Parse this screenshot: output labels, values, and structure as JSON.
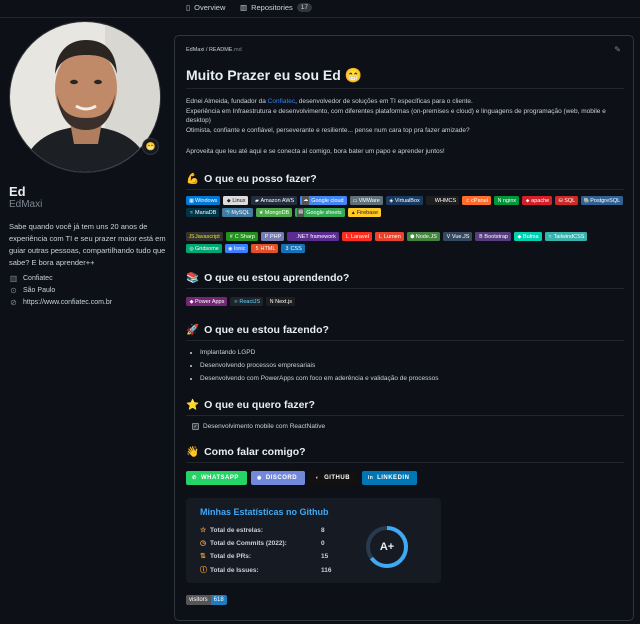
{
  "nav": {
    "overview": "Overview",
    "repositories": "Repositories",
    "repo_count": "17"
  },
  "profile": {
    "name": "Ed",
    "login": "EdMaxi",
    "status_emoji": "😁",
    "bio": "Sabe quando você já tem uns 20 anos de experiência com TI e seu prazer maior está em guiar outras pessoas, compartilhando tudo que sabe? E bora aprender++",
    "company": "Confiatec",
    "location": "São Paulo",
    "website": "https://www.confiatec.com.br"
  },
  "readme": {
    "crumb_user": "EdMaxi",
    "crumb_sep": " / ",
    "crumb_file": "README",
    "crumb_ext": ".md",
    "title": "Muito Prazer eu sou Ed 😁",
    "intro_a": "Ednei Almeida, fundador da ",
    "intro_link": "Confiatec",
    "intro_b": ", desenvolvedor de soluções em TI específicas para o cliente.",
    "intro_2": "Experiência em Infraestrutura e desenvolvimento, com diferentes plataformas (on-premises e cloud) e linguagens de programação (web, mobile e desktop)",
    "intro_3": "Otimista, confiante e confiável, perseverante e resiliente... pense num cara top pra fazer amizade?",
    "intro_4": "Aproveita que leu até aqui e se conecta aí comigo, bora bater um papo e aprender juntos!",
    "h_can": "O que eu posso fazer?",
    "h_can_icon": "💪",
    "h_learn": "O que eu estou aprendendo?",
    "h_learn_icon": "📚",
    "h_doing": "O que eu estou fazendo?",
    "h_doing_icon": "🚀",
    "h_want": "O que eu quero fazer?",
    "h_want_icon": "⭐",
    "h_talk": "Como falar comigo?",
    "h_talk_icon": "👋",
    "doing": [
      "Implantando LGPD",
      "Desenvolvendo processos empresariais",
      "Desenvolvendo com PowerApps com foco em aderência e validação de processos"
    ],
    "want": "Desenvolvimento mobile com ReactNative"
  },
  "badges_infra": [
    {
      "label": "Windows",
      "color": "#0078D6",
      "icon": "▦"
    },
    {
      "label": "Linux",
      "color": "#dddddd",
      "icon": "◆",
      "dark": true
    },
    {
      "label": "Amazon AWS",
      "color": "#232F3E",
      "icon": "▰"
    },
    {
      "label": "Google cloud",
      "color": "#4285F4",
      "icon": "☁",
      "split": "#555"
    },
    {
      "label": "VMWare",
      "color": "#607078",
      "icon": "▭"
    },
    {
      "label": "VirtualBox",
      "color": "#183A61",
      "icon": "◈"
    },
    {
      "label": "WHMCS",
      "color": "#1e1e1e",
      "icon": ""
    },
    {
      "label": "cPanel",
      "color": "#FF6C2C",
      "icon": "c"
    },
    {
      "label": "nginx",
      "color": "#009639",
      "icon": "N"
    },
    {
      "label": "apache",
      "color": "#D42029",
      "icon": "⬥"
    },
    {
      "label": "SQL",
      "color": "#CC2927",
      "icon": "⛁"
    },
    {
      "label": "PostgreSQL",
      "color": "#316192",
      "icon": "🐘"
    },
    {
      "label": "MariaDB",
      "color": "#003545",
      "icon": "≈"
    },
    {
      "label": "MySQL",
      "color": "#4479A1",
      "icon": "🐬"
    },
    {
      "label": "MongoDB",
      "color": "#4ea94b",
      "icon": "❦"
    },
    {
      "label": "Google sheets",
      "color": "#34A853",
      "icon": "▤",
      "split": "#555"
    },
    {
      "label": "Firebase",
      "color": "#ffca28",
      "icon": "▲",
      "dark": true
    }
  ],
  "badges_dev": [
    {
      "label": "Javascript",
      "color": "#323330",
      "icon": "JS",
      "text": "#F7DF1E"
    },
    {
      "label": "C Sharp",
      "color": "#239120",
      "icon": "#"
    },
    {
      "label": "PHP",
      "color": "#777BB4",
      "icon": "P"
    },
    {
      "label": ".NET framework",
      "color": "#5C2D91",
      "icon": ""
    },
    {
      "label": "Laravel",
      "color": "#FF2D20",
      "icon": "L"
    },
    {
      "label": "Lumen",
      "color": "#E74430",
      "icon": "L"
    },
    {
      "label": "Node.JS",
      "color": "#43853D",
      "icon": "⬢"
    },
    {
      "label": "Vue.JS",
      "color": "#35495E",
      "icon": "V"
    },
    {
      "label": "Bootstrap",
      "color": "#563D7C",
      "icon": "B"
    },
    {
      "label": "Bulma",
      "color": "#00D1B2",
      "icon": "◆"
    },
    {
      "label": "TailwindCSS",
      "color": "#38B2AC",
      "icon": "≈"
    },
    {
      "label": "Gridsome",
      "color": "#00A672",
      "icon": "◎"
    },
    {
      "label": "Ionic",
      "color": "#3880FF",
      "icon": "◉"
    },
    {
      "label": "HTML",
      "color": "#E34F26",
      "icon": "5"
    },
    {
      "label": "CSS",
      "color": "#1572B6",
      "icon": "3"
    }
  ],
  "badges_learn": [
    {
      "label": "Power Apps",
      "color": "#742774",
      "icon": "◆"
    },
    {
      "label": "ReactJS",
      "color": "#20232a",
      "icon": "⚛",
      "text": "#61DAFB"
    },
    {
      "label": "Next.js",
      "color": "#1e1e1e",
      "icon": "N"
    }
  ],
  "badges_contact": [
    {
      "label": "WHATSAPP",
      "color": "#25D366",
      "icon": "✆"
    },
    {
      "label": "DISCORD",
      "color": "#7289DA",
      "icon": "◉"
    },
    {
      "label": "GITHUB",
      "color": "#121011",
      "icon": "◐"
    },
    {
      "label": "LINKEDIN",
      "color": "#0077B5",
      "icon": "in"
    }
  ],
  "stats": {
    "title": "Minhas Estatísticas no Github",
    "rows": [
      {
        "label": "Total de estrelas:",
        "value": "8",
        "icon": "☆"
      },
      {
        "label": "Total de Commits (2022):",
        "value": "0",
        "icon": "◷"
      },
      {
        "label": "Total de PRs:",
        "value": "15",
        "icon": "⇅"
      },
      {
        "label": "Total de Issues:",
        "value": "116",
        "icon": "ⓘ"
      }
    ],
    "grade": "A+",
    "ring_fraction": 0.65,
    "ring_color": "#3fa9f5"
  },
  "visitors": {
    "label": "visitors",
    "count": "618"
  }
}
